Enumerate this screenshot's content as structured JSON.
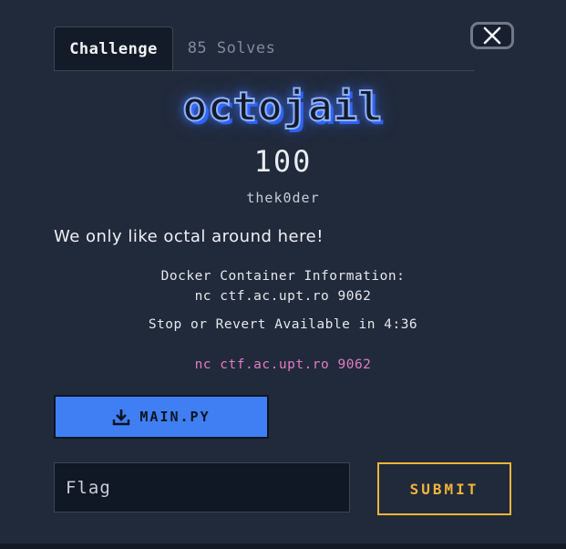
{
  "tabs": {
    "challenge": "Challenge",
    "solves": "85 Solves"
  },
  "challenge": {
    "name": "octojail",
    "points": "100",
    "author": "thek0der",
    "description": "We only like octal around here!"
  },
  "docker": {
    "heading": "Docker Container Information:",
    "connection": "nc ctf.ac.upt.ro 9062",
    "timer": "Stop or Revert Available in 4:36",
    "link": "nc ctf.ac.upt.ro 9062"
  },
  "file": {
    "label": "MAIN.PY",
    "icon": "download-icon"
  },
  "flag": {
    "placeholder": "Flag",
    "value": ""
  },
  "submit": {
    "label": "SUBMIT"
  },
  "close": {
    "icon": "close-icon"
  },
  "colors": {
    "background": "#212a3a",
    "accent_blue": "#3f7ff3",
    "submit_gold": "#f0b43a",
    "link_pink": "#e07cc5"
  }
}
